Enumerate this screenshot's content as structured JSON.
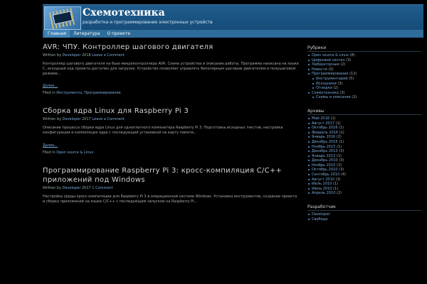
{
  "site": {
    "title": "Схемотехника",
    "description": "разработка и программирование электронных устройств"
  },
  "nav": [
    "Главная",
    "Литература",
    "О проекте"
  ],
  "posts": [
    {
      "title": "AVR: ЧПУ. Контроллер шагового двигателя",
      "meta_prefix": "Written by",
      "author": "Developer",
      "date": "2018",
      "comments": "Leave a Comment",
      "excerpt": "Контроллер шагового двигателя на базе микроконтроллера AVR. Схема устройства и описание работы. Программа написана на языке C, исходный код проекта доступен для загрузки. Устройство позволяет управлять биполярным шаговым двигателем в полушаговом режиме...",
      "more": "Далее...",
      "foot_prefix": "Filed in",
      "categories": "Инструменты, Программирование"
    },
    {
      "title": "Сборка ядра Linux для Raspberry Pi 3",
      "meta_prefix": "Written by",
      "author": "Developer",
      "date": "2017",
      "comments": "Leave a Comment",
      "excerpt": "Описание процесса сборки ядра Linux для одноплатного компьютера Raspberry Pi 3. Подготовка исходных текстов, настройка конфигурации и компиляция ядра с последующей установкой на карту памяти...",
      "more": "Далее...",
      "foot_prefix": "Filed in",
      "categories": "Open source & Linux"
    },
    {
      "title": "Программирование Raspberry Pi 3: кросс-компиляция C/C++ приложений под Windows",
      "meta_prefix": "Written by",
      "author": "Developer",
      "date": "2017",
      "comments": "1 Comment",
      "excerpt": "Настройка среды кросс-компиляции для Raspberry Pi 3 в операционной системе Windows. Установка инструментов, создание проекта и сборка приложений на языке C/C++ с последующим запуском на Raspberry Pi...",
      "more": "",
      "foot_prefix": "",
      "categories": ""
    }
  ],
  "sidebar": {
    "categories_title": "Рубрики",
    "categories": [
      {
        "label": "Open source & Linux",
        "count": "(8)",
        "sub": false
      },
      {
        "label": "Цифровой синтез",
        "count": "(3)",
        "sub": false
      },
      {
        "label": "Лабораторные",
        "count": "(2)",
        "sub": false
      },
      {
        "label": "Новости",
        "count": "(3)",
        "sub": false
      },
      {
        "label": "Программирование",
        "count": "(12)",
        "sub": false
      },
      {
        "label": "Инструментарий",
        "count": "(5)",
        "sub": true
      },
      {
        "label": "Исходники",
        "count": "(3)",
        "sub": true
      },
      {
        "label": "Отладка",
        "count": "(2)",
        "sub": true
      },
      {
        "label": "Схемотехника",
        "count": "(3)",
        "sub": false
      },
      {
        "label": "Схемы и описание",
        "count": "(2)",
        "sub": true
      }
    ],
    "archives_title": "Архивы",
    "archives": [
      {
        "label": "Май 2018",
        "count": "(1)"
      },
      {
        "label": "Август 2017",
        "count": "(1)"
      },
      {
        "label": "Октябрь 2016",
        "count": "(1)"
      },
      {
        "label": "Февраль 2016",
        "count": "(1)"
      },
      {
        "label": "Январь 2016",
        "count": "(2)"
      },
      {
        "label": "Декабрь 2015",
        "count": "(1)"
      },
      {
        "label": "Ноябрь 2015",
        "count": "(1)"
      },
      {
        "label": "Декабрь 2013",
        "count": "(3)"
      },
      {
        "label": "Январь 2013",
        "count": "(1)"
      },
      {
        "label": "Декабрь 2010",
        "count": "(3)"
      },
      {
        "label": "Ноябрь 2010",
        "count": "(3)"
      },
      {
        "label": "Октябрь 2010",
        "count": "(3)"
      },
      {
        "label": "Сентябрь 2010",
        "count": "(4)"
      },
      {
        "label": "Август 2010",
        "count": "(3)"
      },
      {
        "label": "Июль 2010",
        "count": "(1)"
      },
      {
        "label": "Июнь 2010",
        "count": "(1)"
      },
      {
        "label": "Апрель 2010",
        "count": "(2)"
      }
    ],
    "meta_title": "Разработчик",
    "meta": [
      {
        "label": "Developer"
      },
      {
        "label": "Свобода"
      }
    ]
  }
}
